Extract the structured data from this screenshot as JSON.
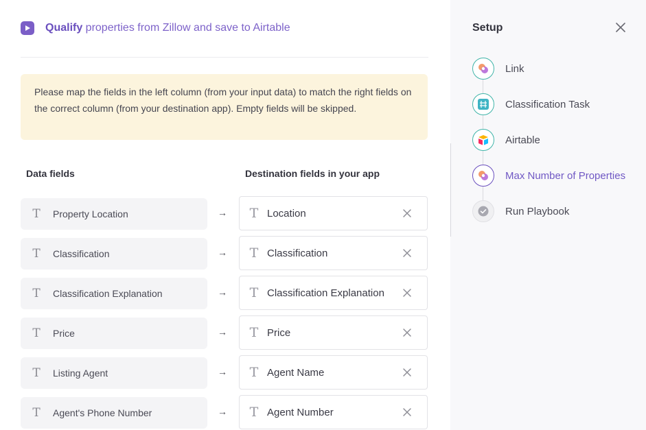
{
  "header": {
    "title_bold": "Qualify",
    "title_rest": " properties from Zillow and save to Airtable"
  },
  "notice": "Please map the fields in the left column (from your input data) to match the right fields on the correct column (from your destination app). Empty fields will be skipped.",
  "columns": {
    "data_fields": "Data fields",
    "destination_fields": "Destination fields in your app"
  },
  "mappings": [
    {
      "source": "Property Location",
      "destination": "Location"
    },
    {
      "source": "Classification",
      "destination": "Classification"
    },
    {
      "source": "Classification Explanation",
      "destination": "Classification Explanation"
    },
    {
      "source": "Price",
      "destination": "Price"
    },
    {
      "source": "Listing Agent",
      "destination": "Agent Name"
    },
    {
      "source": "Agent's Phone Number",
      "destination": "Agent Number"
    }
  ],
  "arrow_glyph": "→",
  "text_type_glyph": "T",
  "sidebar": {
    "title": "Setup",
    "steps": [
      {
        "label": "Link",
        "icon": "link-app-icon",
        "state": "done"
      },
      {
        "label": "Classification Task",
        "icon": "classification-task-icon",
        "state": "done"
      },
      {
        "label": "Airtable",
        "icon": "airtable-icon",
        "state": "done"
      },
      {
        "label": "Max Number of Properties",
        "icon": "max-properties-icon",
        "state": "active"
      },
      {
        "label": "Run Playbook",
        "icon": "check-icon",
        "state": "pending"
      }
    ]
  },
  "colors": {
    "accent": "#6a4fbe",
    "teal": "#3fb4a8",
    "notice_bg": "#fcf4dd",
    "sidebar_bg": "#f8f8fa"
  }
}
